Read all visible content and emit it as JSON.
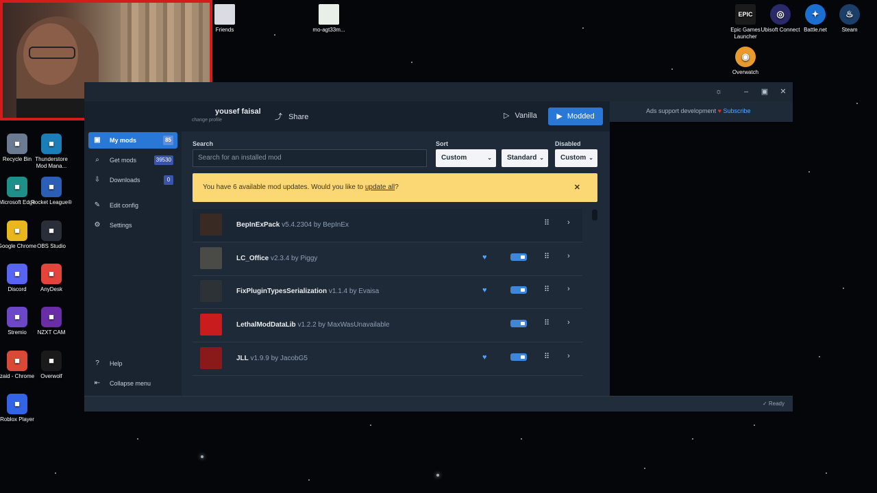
{
  "desktop": {
    "left_icons": [
      {
        "label": "Recycle Bin",
        "icon": "recycle-bin-icon",
        "color": "#6b7c92"
      },
      {
        "label": "Thunderstore Mod Mana...",
        "icon": "thunderstore-icon",
        "color": "#1a7fb8"
      },
      {
        "label": "Microsoft Edge",
        "icon": "edge-icon",
        "color": "#1f8f8a"
      },
      {
        "label": "Rocket League®",
        "icon": "rocket-league-icon",
        "color": "#2b5fb6"
      },
      {
        "label": "Google Chrome",
        "icon": "chrome-icon",
        "color": "#e7b71d"
      },
      {
        "label": "OBS Studio",
        "icon": "obs-icon",
        "color": "#2a2e38"
      },
      {
        "label": "Discord",
        "icon": "discord-icon",
        "color": "#5865f2"
      },
      {
        "label": "AnyDesk",
        "icon": "anydesk-icon",
        "color": "#e3443b"
      },
      {
        "label": "Stremio",
        "icon": "stremio-icon",
        "color": "#6c48c9"
      },
      {
        "label": "NZXT CAM",
        "icon": "nzxt-icon",
        "color": "#6a2da8"
      },
      {
        "label": "zaid - Chrome",
        "icon": "chrome-icon",
        "color": "#d84a36"
      },
      {
        "label": "Overwolf",
        "icon": "overwolf-icon",
        "color": "#1a1a1a"
      },
      {
        "label": "Roblox Player",
        "icon": "roblox-icon",
        "color": "#3264e5"
      }
    ],
    "top_icons": [
      {
        "label": "Friends",
        "icon": "folder-icon",
        "color": "#d9dde3"
      },
      {
        "label": "mo-agt33m...",
        "icon": "document-icon",
        "color": "#e8efe8"
      }
    ],
    "right_icons": [
      {
        "label": "Epic Games Launcher",
        "icon": "epic-games-icon",
        "color": "#1b1b1b",
        "glyph": "EPIC"
      },
      {
        "label": "Ubisoft Connect",
        "icon": "ubisoft-icon",
        "color": "#2a2a6a",
        "glyph": "◎"
      },
      {
        "label": "Battle.net",
        "icon": "battlenet-icon",
        "color": "#1a6fd1",
        "glyph": "✦"
      },
      {
        "label": "Steam",
        "icon": "steam-icon",
        "color": "#1b3f68",
        "glyph": "♨"
      },
      {
        "label": "Overwatch",
        "icon": "overwatch-icon",
        "color": "#e89a2e",
        "glyph": "◉"
      }
    ]
  },
  "app": {
    "topbar": {
      "profile_name": "yousef faisal",
      "profile_sub": "change profile",
      "share": "Share",
      "vanilla": "Vanilla",
      "modded": "Modded"
    },
    "ads": {
      "text": "Ads support development",
      "subscribe": "Subscribe"
    },
    "sidebar": {
      "items": [
        {
          "label": "My mods",
          "badge": "85",
          "icon": "box-icon",
          "active": true
        },
        {
          "label": "Get mods",
          "badge": "39530",
          "icon": "search-icon",
          "active": false
        },
        {
          "label": "Downloads",
          "badge": "0",
          "icon": "download-icon",
          "active": false
        },
        {
          "label": "Edit config",
          "badge": "",
          "icon": "edit-icon",
          "active": false
        },
        {
          "label": "Settings",
          "badge": "",
          "icon": "gear-icon",
          "active": false
        }
      ],
      "help": "Help",
      "collapse": "Collapse menu"
    },
    "filters": {
      "search_label": "Search",
      "search_placeholder": "Search for an installed mod",
      "sort_label": "Sort",
      "sort_value": "Custom",
      "sort_order": "Standard",
      "disabled_label": "Disabled",
      "disabled_value": "Custom"
    },
    "banner": {
      "prefix": "You have 6 available mod updates. Would you like to ",
      "link": "update all",
      "suffix": "?"
    },
    "mods": [
      {
        "name": "BepInExPack",
        "meta": " v5.4.2304 by BepInEx",
        "favorite": false,
        "enabled": false,
        "color": "#3a2a24"
      },
      {
        "name": "LC_Office",
        "meta": " v2.3.4 by Piggy",
        "favorite": true,
        "enabled": true,
        "color": "#4a4a46"
      },
      {
        "name": "FixPluginTypesSerialization",
        "meta": " v1.1.4 by Evaisa",
        "favorite": true,
        "enabled": true,
        "color": "#2c3236"
      },
      {
        "name": "LethalModDataLib",
        "meta": " v1.2.2 by MaxWasUnavailable",
        "favorite": false,
        "enabled": true,
        "color": "#c91d1d"
      },
      {
        "name": "JLL",
        "meta": " v1.9.9 by JacobG5",
        "favorite": true,
        "enabled": true,
        "color": "#8a1a1a"
      }
    ],
    "status": "Ready"
  }
}
